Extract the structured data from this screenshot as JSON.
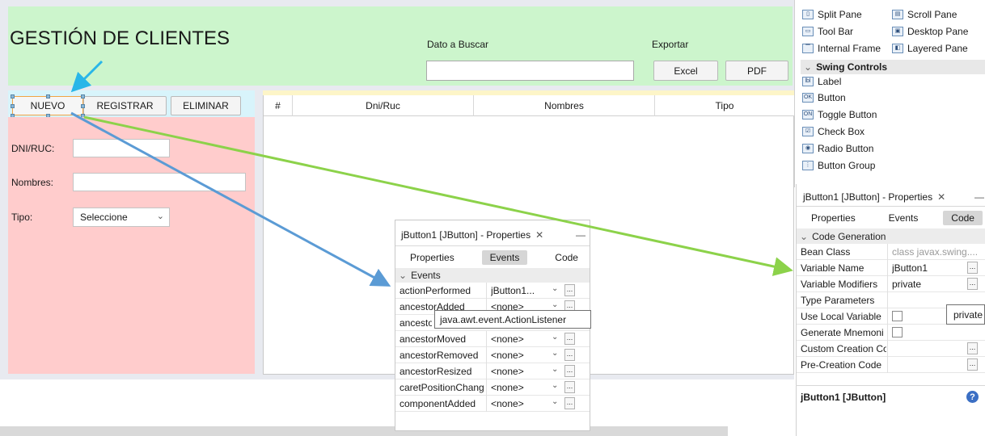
{
  "form": {
    "title": "GESTIÓN DE CLIENTES",
    "search_label": "Dato a Buscar",
    "export_label": "Exportar",
    "excel_label": "Excel",
    "pdf_label": "PDF",
    "nuevo_label": "NUEVO",
    "registrar_label": "REGISTRAR",
    "eliminar_label": "ELIMINAR",
    "dni_label": "DNI/RUC:",
    "nombres_label": "Nombres:",
    "tipo_label": "Tipo:",
    "tipo_value": "Seleccione",
    "table_columns": [
      "#",
      "Dni/Ruc",
      "Nombres",
      "Tipo"
    ]
  },
  "palette": {
    "items": [
      {
        "label": "Split Pane",
        "icon": "split-pane-icon"
      },
      {
        "label": "Scroll Pane",
        "icon": "scroll-pane-icon"
      },
      {
        "label": "Tool Bar",
        "icon": "tool-bar-icon"
      },
      {
        "label": "Desktop Pane",
        "icon": "desktop-pane-icon"
      },
      {
        "label": "Internal Frame",
        "icon": "internal-frame-icon"
      },
      {
        "label": "Layered Pane",
        "icon": "layered-pane-icon"
      }
    ],
    "group": "Swing Controls",
    "controls": [
      {
        "label": "Label",
        "icon": "label-icon"
      },
      {
        "label": "Button",
        "icon": "button-icon"
      },
      {
        "label": "Toggle Button",
        "icon": "toggle-button-icon"
      },
      {
        "label": "Check Box",
        "icon": "check-box-icon"
      },
      {
        "label": "Radio Button",
        "icon": "radio-button-icon"
      },
      {
        "label": "Button Group",
        "icon": "button-group-icon"
      }
    ]
  },
  "right_props": {
    "title": "jButton1 [JButton] - Properties",
    "tabs": [
      "Properties",
      "Events",
      "Code"
    ],
    "active_tab": "Code",
    "group": "Code Generation",
    "rows": [
      {
        "key": "Bean Class",
        "value": "class javax.swing...."
      },
      {
        "key": "Variable Name",
        "value": "jButton1"
      },
      {
        "key": "Variable Modifiers",
        "value": "private"
      },
      {
        "key": "Type Parameters",
        "value": ""
      },
      {
        "key": "Use Local Variable",
        "value": ""
      },
      {
        "key": "Generate Mnemoni",
        "value": ""
      },
      {
        "key": "Custom Creation Co",
        "value": ""
      },
      {
        "key": "Pre-Creation Code",
        "value": ""
      }
    ],
    "tooltip": "private",
    "footer": "jButton1 [JButton]"
  },
  "popup_props": {
    "title": "jButton1 [JButton] - Properties",
    "tabs": [
      "Properties",
      "Events",
      "Code"
    ],
    "active_tab": "Events",
    "group": "Events",
    "rows": [
      {
        "key": "actionPerformed",
        "value": "jButton1..."
      },
      {
        "key": "ancestorAdded",
        "value": "<none>"
      },
      {
        "key": "ancestorMoved",
        "value": "<none>"
      },
      {
        "key": "ancestorRemoved",
        "value": "<none>"
      },
      {
        "key": "ancestorResized",
        "value": "<none>"
      },
      {
        "key": "caretPositionChang",
        "value": "<none>"
      },
      {
        "key": "componentAdded",
        "value": "<none>"
      }
    ],
    "tooltip": "java.awt.event.ActionListener"
  },
  "colors": {
    "header_green": "#ccf5cc",
    "panel_pink": "#ffcccc",
    "arrow_cyan": "#29b6e8",
    "arrow_blue": "#5b9bd5",
    "arrow_green": "#8cd24a"
  }
}
